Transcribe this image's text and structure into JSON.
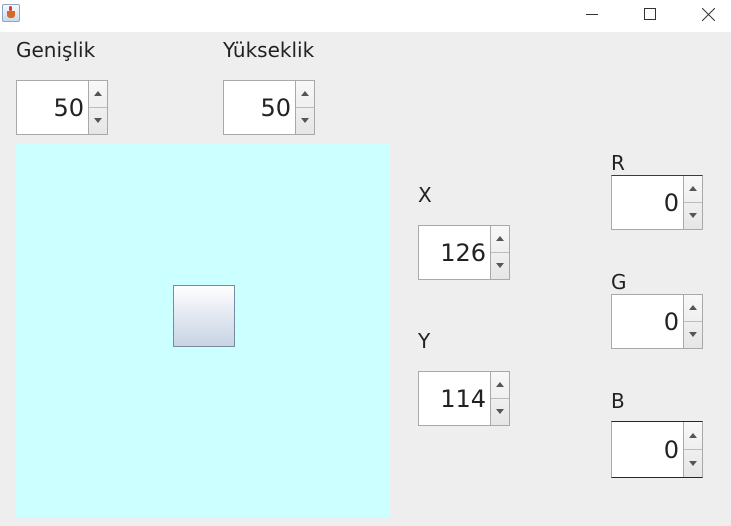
{
  "window": {
    "icon": "java-cup-icon",
    "controls": [
      "minimize-icon",
      "maximize-icon",
      "close-icon"
    ]
  },
  "width_control": {
    "label": "Genişlik",
    "value": "50"
  },
  "height_control": {
    "label": "Yükseklik",
    "value": "50"
  },
  "x_control": {
    "label": "X",
    "value": "126"
  },
  "y_control": {
    "label": "Y",
    "value": "114"
  },
  "r_control": {
    "label": "R",
    "value": "0",
    "accent": "#8b1a1a"
  },
  "g_control": {
    "label": "G",
    "value": "0"
  },
  "b_control": {
    "label": "B",
    "value": "0",
    "accent": "#1a1a8b"
  },
  "canvas": {
    "background": "#ccffff"
  }
}
